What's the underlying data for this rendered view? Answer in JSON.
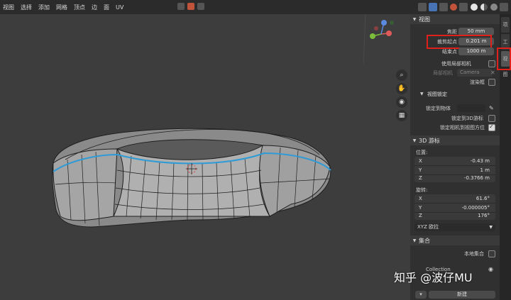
{
  "menu": [
    "视图",
    "选择",
    "添加",
    "网格",
    "顶点",
    "边",
    "面",
    "UV"
  ],
  "sidebar": {
    "view_section": "视图",
    "focal_label": "焦距",
    "focal_value": "50 mm",
    "clip_start_label": "裁剪起点",
    "clip_start_value": "0.201 m",
    "clip_end_label": "结束点",
    "clip_end_value": "1000 m",
    "local_camera_label": "使用局部相机",
    "local_camera_sub": "局部相机",
    "camera_value": "Camera",
    "render_region_label": "渲染框",
    "view_lock_section": "视图锁定",
    "lock_to_object_label": "锁定到物体",
    "lock_3d_cursor_label": "锁定到3D游标",
    "lock_camera_label": "锁定相机到视图方位",
    "cursor_section": "3D 游标",
    "location_label": "位置:",
    "loc_x": "-0.43 m",
    "loc_y": "1 m",
    "loc_z": "-0.3766 m",
    "rotation_label": "旋转:",
    "rot_x": "61.6°",
    "rot_y": "-0.000005°",
    "rot_z": "176°",
    "rotation_mode": "XYZ 欧拉",
    "collection_section": "集合",
    "local_collection_label": "本地集合",
    "collection_name": "Collection",
    "new_button": "新建",
    "x": "X",
    "y": "Y",
    "z": "Z"
  },
  "tabs": [
    "项",
    "工具",
    "视图"
  ],
  "watermark": "知乎 @波仔MU",
  "colors": {
    "highlight": "#e0201a",
    "accent": "#4772b3",
    "mesh_edge_blue": "#2e9bd6"
  }
}
